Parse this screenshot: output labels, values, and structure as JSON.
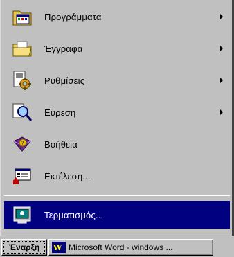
{
  "start_menu": {
    "items": [
      {
        "label": "Προγράμματα",
        "has_submenu": true,
        "icon": "programs-folder-icon"
      },
      {
        "label": "Έγγραφα",
        "has_submenu": true,
        "icon": "documents-folder-icon"
      },
      {
        "label": "Ρυθμίσεις",
        "has_submenu": true,
        "icon": "settings-icon"
      },
      {
        "label": "Εύρεση",
        "has_submenu": true,
        "icon": "find-icon"
      },
      {
        "label": "Βοήθεια",
        "has_submenu": false,
        "icon": "help-book-icon"
      },
      {
        "label": "Εκτέλεση...",
        "has_submenu": false,
        "icon": "run-icon"
      },
      {
        "label": "Τερματισμός...",
        "has_submenu": false,
        "icon": "shutdown-icon",
        "selected": true
      }
    ]
  },
  "taskbar": {
    "start_label": "Έναρξη",
    "task_label": "Microsoft Word - windows ..."
  },
  "colors": {
    "menu_bg": "#c0c0c0",
    "highlight": "#000080",
    "highlight_text": "#ffffff"
  }
}
